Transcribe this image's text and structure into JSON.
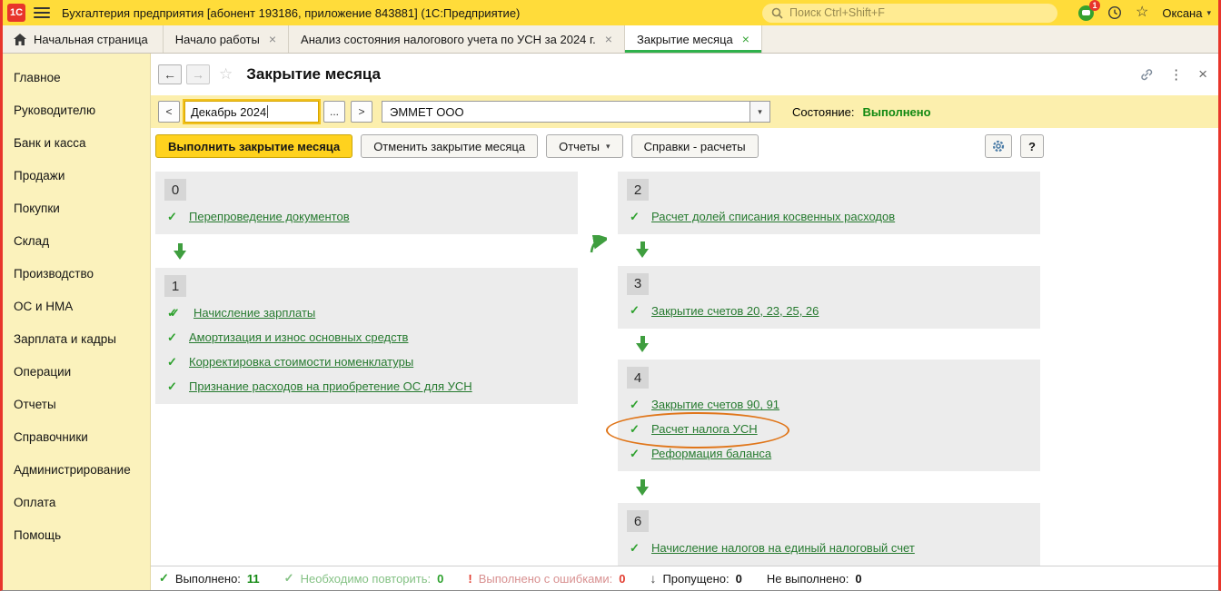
{
  "topbar": {
    "logo": "1С",
    "title": "Бухгалтерия предприятия [абонент 193186, приложение 843881]  (1С:Предприятие)",
    "search_placeholder": "Поиск Ctrl+Shift+F",
    "notification_count": "1",
    "user": "Оксана"
  },
  "tabs": {
    "home_label": "Начальная страница",
    "items": [
      {
        "label": "Начало работы",
        "active": false
      },
      {
        "label": "Анализ состояния налогового учета по УСН за 2024 г.",
        "active": false
      },
      {
        "label": "Закрытие месяца",
        "active": true
      }
    ]
  },
  "sidebar": {
    "items": [
      "Главное",
      "Руководителю",
      "Банк и касса",
      "Продажи",
      "Покупки",
      "Склад",
      "Производство",
      "ОС и НМА",
      "Зарплата и кадры",
      "Операции",
      "Отчеты",
      "Справочники",
      "Администрирование",
      "Оплата",
      "Помощь"
    ]
  },
  "page": {
    "title": "Закрытие месяца",
    "period_prev": "<",
    "period_value": "Декабрь 2024",
    "period_pick": "...",
    "period_next": ">",
    "organization": "ЭММЕТ ООО",
    "status_label": "Состояние:",
    "status_value": "Выполнено"
  },
  "toolbar": {
    "run_label": "Выполнить закрытие месяца",
    "cancel_label": "Отменить закрытие месяца",
    "reports_label": "Отчеты",
    "certificates_label": "Справки - расчеты",
    "help_label": "?"
  },
  "steps": {
    "left_blocks": [
      {
        "number": "0",
        "items": [
          {
            "label": "Перепроведение документов",
            "check": "single"
          }
        ]
      },
      {
        "number": "1",
        "items": [
          {
            "label": "Начисление зарплаты",
            "check": "double"
          },
          {
            "label": "Амортизация и износ основных средств",
            "check": "single"
          },
          {
            "label": "Корректировка стоимости номенклатуры",
            "check": "single"
          },
          {
            "label": "Признание расходов на приобретение ОС для УСН",
            "check": "single"
          }
        ]
      }
    ],
    "right_blocks": [
      {
        "number": "2",
        "items": [
          {
            "label": "Расчет долей списания косвенных расходов",
            "check": "single"
          }
        ]
      },
      {
        "number": "3",
        "items": [
          {
            "label": "Закрытие счетов 20, 23, 25, 26",
            "check": "single"
          }
        ]
      },
      {
        "number": "4",
        "items": [
          {
            "label": "Закрытие счетов 90, 91",
            "check": "single"
          },
          {
            "label": "Расчет налога УСН",
            "check": "single",
            "highlighted": true
          },
          {
            "label": "Реформация баланса",
            "check": "single"
          }
        ]
      },
      {
        "number": "6",
        "items": [
          {
            "label": "Начисление налогов на единый налоговый счет",
            "check": "single"
          }
        ]
      }
    ]
  },
  "footer": {
    "stats": [
      {
        "label": "Выполнено:",
        "value": "11"
      },
      {
        "label": "Необходимо повторить:",
        "value": "0"
      },
      {
        "label": "Выполнено с ошибками:",
        "value": "0"
      },
      {
        "label": "Пропущено:",
        "value": "0"
      },
      {
        "label": "Не выполнено:",
        "value": "0"
      }
    ]
  },
  "icons": {
    "check": "✓",
    "double_check": "✓✓",
    "close": "×",
    "dropdown": "▾",
    "more": "⋮",
    "star": "☆",
    "back": "←",
    "forward": "→",
    "skipped": "↓",
    "error": "!"
  },
  "colors": {
    "topbar_yellow": "#ffdc3a",
    "sidebar_yellow": "#fbf2bc",
    "band_yellow": "#fcefad",
    "primary_button_yellow": "#ffd21e",
    "link_green": "#267a2f",
    "status_green": "#128912",
    "tab_underline_green": "#2eb14c",
    "arrow_green": "#3f9e3f",
    "error_red": "#e23b2e",
    "highlight_orange": "#e0761a",
    "window_border_red": "#e8352b"
  }
}
